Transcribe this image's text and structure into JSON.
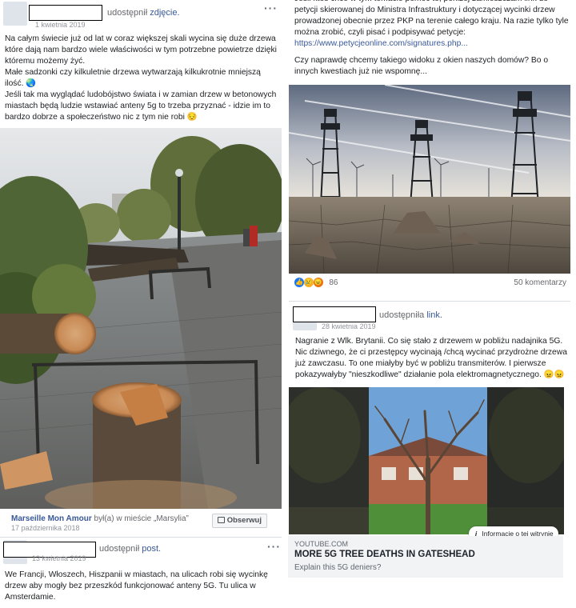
{
  "left_post1": {
    "action_text": "udostępnił",
    "action_link": "zdjęcie.",
    "date": "1 kwietnia 2019",
    "paragraphs": [
      "Na całym świecie już od lat w coraz większej skali wycina się duże drzewa które dają nam bardzo wiele właściwości w tym potrzebne powietrze dzięki któremu możemy żyć.",
      "Małe sadzonki czy kilkuletnie drzewa wytwarzają kilkukrotnie mniejszą ilość. 🌏",
      "Jeśli tak ma wyglądać ludobójstwo świata i w zamian drzew w betonowych miastach będą ludzie wstawiać anteny 5g to trzeba przyznać - idzie im to bardzo dobrze a społeczeństwo nic z tym nie robi 😔"
    ],
    "location_name": "Marseille Mon Amour",
    "location_rest": " był(a) w mieście „Marsylia”",
    "location_date": "17 października 2018",
    "follow_label": "Obserwuj"
  },
  "left_post2": {
    "action_text": "udostępnił",
    "action_link": "post.",
    "date": "13 kwietnia 2019",
    "text": "We Francji, Włoszech, Hiszpanii w miastach, na ulicach robi się wycinkę drzew aby mogły bez przeszkód funkcjonować anteny 5G. Tu ulica w Amsterdamie."
  },
  "right_post1": {
    "text_top": "Jeśli ktoś chce w tym temacie pomóc to, poniżej zamieszczam link do petycji skierowanej do Ministra Infrastruktury i dotyczącej wycinki drzew prowadzonej obecnie przez PKP na terenie całego kraju. Na razie tylko tyle można zrobić, czyli pisać i podpisywać petycje:",
    "link": "https://www.petycjeonline.com/signatures.php...",
    "text_bottom": "Czy naprawdę chcemy takiego widoku z okien naszych domów? Bo o innych kwestiach już nie wspomnę...",
    "reaction_count": "86",
    "comments": "50 komentarzy"
  },
  "right_post2": {
    "action_text": "udostępniła",
    "action_link": "link.",
    "date": "28 kwietnia 2019",
    "text": "Nagranie z Wlk. Brytanii. Co się stało z drzewem w pobliżu nadajnika 5G. Nic dziwnego, że ci przestępcy wycinają /chcą wycinać przydrożne drzewa już zawczasu. To one miałyby być w pobliżu transmiterów. I pierwsze pokazywałyby \"nieszkodliwe\" działanie pola elektromagnetycznego. 😠😠",
    "info_chip": "Informacje o tej witrynie",
    "card_source": "YOUTUBE.COM",
    "card_title": "MORE 5G TREE DEATHS IN GATESHEAD",
    "card_desc": "Explain this 5G deniers?"
  },
  "icons": {
    "more": "more-dots-icon",
    "follow": "follow-icon",
    "info": "info-icon",
    "like": "like-reaction-icon",
    "sad": "sad-reaction-icon",
    "angry": "angry-reaction-icon"
  },
  "colors": {
    "link": "#385898",
    "meta": "#90949c",
    "card_bg": "#f2f3f5"
  }
}
